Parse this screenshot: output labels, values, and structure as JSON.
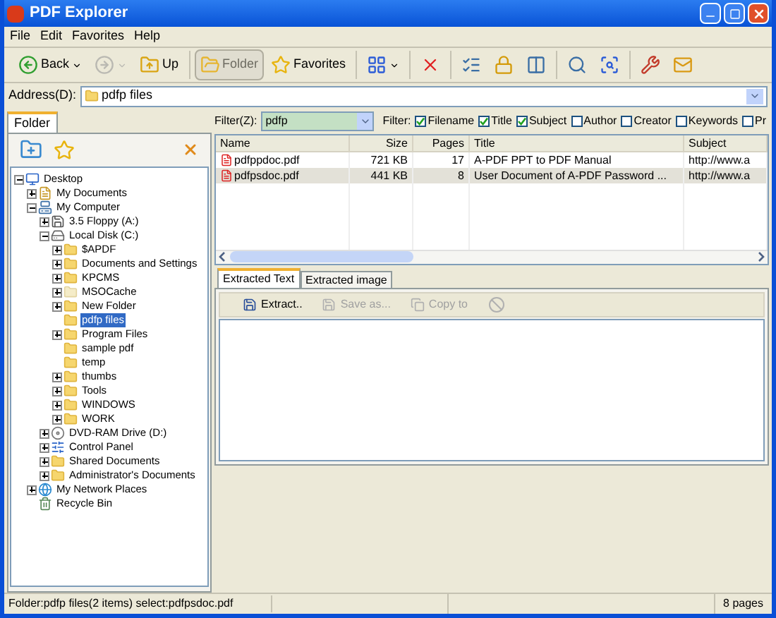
{
  "window": {
    "title": "PDF Explorer"
  },
  "menu": [
    "File",
    "Edit",
    "Favorites",
    "Help"
  ],
  "toolbar": [
    {
      "kind": "back",
      "label": "Back",
      "dropdown": true,
      "pressed": false,
      "disabled": false
    },
    {
      "kind": "forward",
      "dropdown": true,
      "pressed": false,
      "disabled": true
    },
    {
      "kind": "up",
      "label": "Up",
      "dropdown": false,
      "pressed": false,
      "disabled": false
    },
    {
      "kind": "separator"
    },
    {
      "kind": "folder",
      "label": "Folder",
      "dropdown": false,
      "pressed": true,
      "disabled": false
    },
    {
      "kind": "favorites",
      "label": "Favorites",
      "dropdown": false,
      "pressed": false,
      "disabled": false
    },
    {
      "kind": "separator"
    },
    {
      "kind": "view",
      "dropdown": true,
      "pressed": false,
      "disabled": false
    },
    {
      "kind": "separator"
    },
    {
      "kind": "delete",
      "dropdown": false,
      "pressed": false,
      "disabled": false
    },
    {
      "kind": "separator"
    },
    {
      "kind": "properties",
      "dropdown": false,
      "pressed": false,
      "disabled": false
    },
    {
      "kind": "lock",
      "dropdown": false,
      "pressed": false,
      "disabled": false
    },
    {
      "kind": "panel",
      "dropdown": false,
      "pressed": false,
      "disabled": false
    },
    {
      "kind": "separator"
    },
    {
      "kind": "search",
      "dropdown": false,
      "pressed": false,
      "disabled": false
    },
    {
      "kind": "zoom",
      "dropdown": false,
      "pressed": false,
      "disabled": false
    },
    {
      "kind": "separator"
    },
    {
      "kind": "tools",
      "dropdown": false,
      "pressed": false,
      "disabled": false
    },
    {
      "kind": "mail",
      "dropdown": false,
      "pressed": false,
      "disabled": false
    }
  ],
  "address": {
    "label": "Address(D):",
    "value": "pdfp files"
  },
  "folder_pane": {
    "tab": "Folder",
    "tree": [
      {
        "label": "Desktop",
        "kind": "desktop",
        "selected": false,
        "expanded": true,
        "children": [
          {
            "label": "My Documents",
            "kind": "documents",
            "selected": false,
            "expanded": false
          },
          {
            "label": "My Computer",
            "kind": "computer",
            "selected": false,
            "expanded": true,
            "children": [
              {
                "label": "3.5 Floppy (A:)",
                "kind": "floppy",
                "selected": false,
                "expanded": false
              },
              {
                "label": "Local Disk (C:)",
                "kind": "disk",
                "selected": false,
                "expanded": true,
                "children": [
                  {
                    "label": "$APDF",
                    "kind": "folder",
                    "selected": false,
                    "expanded": false
                  },
                  {
                    "label": "Documents and Settings",
                    "kind": "folder",
                    "selected": false,
                    "expanded": false
                  },
                  {
                    "label": "KPCMS",
                    "kind": "folder",
                    "selected": false,
                    "expanded": false
                  },
                  {
                    "label": "MSOCache",
                    "kind": "pale-folder",
                    "selected": false,
                    "expanded": false
                  },
                  {
                    "label": "New Folder",
                    "kind": "folder",
                    "selected": false,
                    "expanded": false
                  },
                  {
                    "label": "pdfp files",
                    "kind": "folder",
                    "selected": true
                  },
                  {
                    "label": "Program Files",
                    "kind": "folder",
                    "selected": false,
                    "expanded": false
                  },
                  {
                    "label": "sample pdf",
                    "kind": "folder",
                    "selected": false
                  },
                  {
                    "label": "temp",
                    "kind": "folder",
                    "selected": false
                  },
                  {
                    "label": "thumbs",
                    "kind": "folder",
                    "selected": false,
                    "expanded": false
                  },
                  {
                    "label": "Tools",
                    "kind": "folder",
                    "selected": false,
                    "expanded": false
                  },
                  {
                    "label": "WINDOWS",
                    "kind": "folder",
                    "selected": false,
                    "expanded": false
                  },
                  {
                    "label": "WORK",
                    "kind": "folder",
                    "selected": false,
                    "expanded": false
                  }
                ]
              },
              {
                "label": "DVD-RAM Drive (D:)",
                "kind": "dvd",
                "selected": false,
                "expanded": false
              },
              {
                "label": "Control Panel",
                "kind": "control-panel",
                "selected": false,
                "expanded": false
              },
              {
                "label": "Shared Documents",
                "kind": "folder",
                "selected": false,
                "expanded": false
              },
              {
                "label": "Administrator's Documents",
                "kind": "folder",
                "selected": false,
                "expanded": false
              }
            ]
          },
          {
            "label": "My Network Places",
            "kind": "network",
            "selected": false,
            "expanded": false
          },
          {
            "label": "Recycle Bin",
            "kind": "recycle",
            "selected": false
          }
        ]
      }
    ]
  },
  "filter": {
    "label": "Filter(Z):",
    "value": "pdfp",
    "fields_label": "Filter:",
    "fields": [
      {
        "label": "Filename",
        "checked": true
      },
      {
        "label": "Title",
        "checked": true
      },
      {
        "label": "Subject",
        "checked": true
      },
      {
        "label": "Author",
        "checked": false
      },
      {
        "label": "Creator",
        "checked": false
      },
      {
        "label": "Keywords",
        "checked": false
      },
      {
        "label": "Pr",
        "checked": false
      }
    ]
  },
  "table": {
    "columns": [
      "Name",
      "Size",
      "Pages",
      "Title",
      "Subject"
    ],
    "rows": [
      {
        "cells": [
          "pdfppdoc.pdf",
          "721 KB",
          "17",
          "A-PDF PPT to PDF Manual",
          "http://www.a"
        ],
        "selected": false
      },
      {
        "cells": [
          "pdfpsdoc.pdf",
          "441 KB",
          "8",
          "User Document of A-PDF Password ...",
          "http://www.a"
        ],
        "selected": true
      }
    ]
  },
  "tabs": [
    {
      "label": "Extracted Text",
      "selected": true
    },
    {
      "label": "Extracted image",
      "selected": false
    }
  ],
  "extract_toolbar": [
    {
      "kind": "save",
      "label": "Extract..",
      "disabled": false
    },
    {
      "kind": "save",
      "label": "Save as...",
      "disabled": true
    },
    {
      "kind": "copy",
      "label": "Copy to",
      "disabled": true
    },
    {
      "kind": "stop",
      "disabled": true
    }
  ],
  "status_bar": {
    "text": "Folder:pdfp files(2 items) select:pdfpsdoc.pdf",
    "pages": "8 pages"
  }
}
